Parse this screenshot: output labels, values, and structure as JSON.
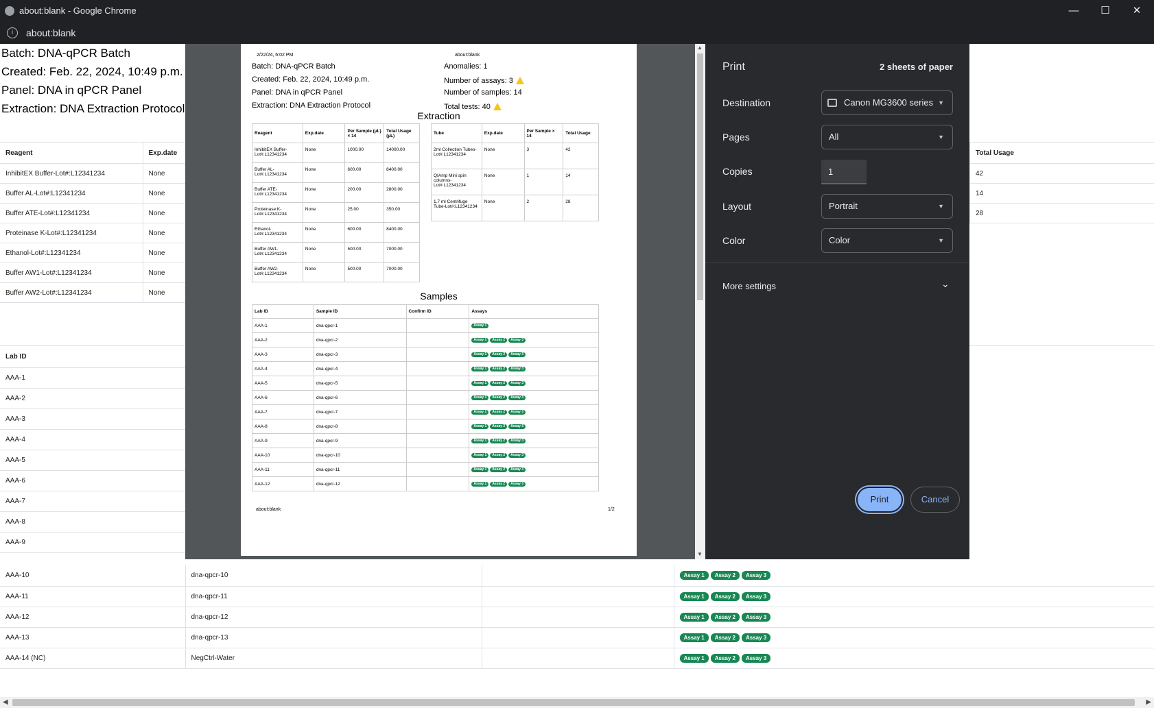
{
  "window": {
    "title": "about:blank - Google Chrome",
    "url": "about:blank",
    "minimize": "—",
    "maximize": "☐",
    "close": "✕"
  },
  "page": {
    "batch": "Batch: DNA-qPCR Batch",
    "created": "Created: Feb. 22, 2024, 10:49 p.m.",
    "panel": "Panel: DNA in qPCR Panel",
    "extraction": "Extraction: DNA Extraction Protocol",
    "reagent_headers": [
      "Reagent",
      "Exp.date"
    ],
    "reagents": [
      {
        "name": "InhibitEX Buffer-Lot#:L12341234",
        "exp": "None"
      },
      {
        "name": "Buffer AL-Lot#:L12341234",
        "exp": "None"
      },
      {
        "name": "Buffer ATE-Lot#:L12341234",
        "exp": "None"
      },
      {
        "name": "Proteinase K-Lot#:L12341234",
        "exp": "None"
      },
      {
        "name": "Ethanol-Lot#:L12341234",
        "exp": "None"
      },
      {
        "name": "Buffer AW1-Lot#:L12341234",
        "exp": "None"
      },
      {
        "name": "Buffer AW2-Lot#:L12341234",
        "exp": "None"
      }
    ],
    "total_usage_header": "Total Usage",
    "total_usage_values": [
      "42",
      "14",
      "28"
    ],
    "lab_id_header": "Lab ID",
    "lab_ids_top": [
      "AAA-1",
      "AAA-2",
      "AAA-3",
      "AAA-4",
      "AAA-5",
      "AAA-6",
      "AAA-7",
      "AAA-8",
      "AAA-9"
    ],
    "lower_rows": [
      {
        "lab": "AAA-10",
        "sample": "dna-qpcr-10"
      },
      {
        "lab": "AAA-11",
        "sample": "dna-qpcr-11"
      },
      {
        "lab": "AAA-12",
        "sample": "dna-qpcr-12"
      },
      {
        "lab": "AAA-13",
        "sample": "dna-qpcr-13"
      },
      {
        "lab": "AAA-14 (NC)",
        "sample": "NegCtrl-Water"
      }
    ],
    "assays": [
      "Assay 1",
      "Assay 2",
      "Assay 3"
    ]
  },
  "print_panel": {
    "title": "Print",
    "sheets": "2 sheets of paper",
    "destination_label": "Destination",
    "destination_value": "Canon MG3600 series",
    "pages_label": "Pages",
    "pages_value": "All",
    "copies_label": "Copies",
    "copies_value": "1",
    "layout_label": "Layout",
    "layout_value": "Portrait",
    "color_label": "Color",
    "color_value": "Color",
    "more_settings": "More settings",
    "print_button": "Print",
    "cancel_button": "Cancel"
  },
  "preview": {
    "header_date": "2/22/24, 6:02 PM",
    "header_url": "about:blank",
    "batch": "Batch: DNA-qPCR Batch",
    "created": "Created: Feb. 22, 2024, 10:49 p.m.",
    "panel": "Panel: DNA in qPCR Panel",
    "extraction": "Extraction: DNA Extraction Protocol",
    "anomalies": "Anomalies: 1",
    "assays_count": "Number of assays: 3",
    "samples_count": "Number of samples: 14",
    "total_tests": "Total tests: 40",
    "extraction_title": "Extraction",
    "reagent_headers": [
      "Reagent",
      "Exp.date",
      "Per Sample (µL) × 14",
      "Total Usage (µL)"
    ],
    "reagents": [
      {
        "name": "InhibitEX Buffer-Lot#:L12341234",
        "exp": "None",
        "per": "1000.00",
        "total": "14000.00"
      },
      {
        "name": "Buffer AL-Lot#:L12341234",
        "exp": "None",
        "per": "600.00",
        "total": "8400.00"
      },
      {
        "name": "Buffer ATE-Lot#:L12341234",
        "exp": "None",
        "per": "200.00",
        "total": "2800.00"
      },
      {
        "name": "Proteinase K-Lot#:L12341234",
        "exp": "None",
        "per": "25.00",
        "total": "350.00"
      },
      {
        "name": "Ethanol-Lot#:L12341234",
        "exp": "None",
        "per": "600.00",
        "total": "8400.00"
      },
      {
        "name": "Buffer AW1-Lot#:L12341234",
        "exp": "None",
        "per": "500.00",
        "total": "7000.00"
      },
      {
        "name": "Buffer AW2-Lot#:L12341234",
        "exp": "None",
        "per": "500.00",
        "total": "7000.00"
      }
    ],
    "tube_headers": [
      "Tube",
      "Exp.date",
      "Per Sample × 14",
      "Total Usage"
    ],
    "tubes": [
      {
        "name": "2ml Collection Tubes-Lot#:L12341234",
        "exp": "None",
        "per": "3",
        "total": "42"
      },
      {
        "name": "QIAmp Mini spin columns-Lot#:L12341234",
        "exp": "None",
        "per": "1",
        "total": "14"
      },
      {
        "name": "1.7 ml Centrifuge Tube-Lot#:L12341234",
        "exp": "None",
        "per": "2",
        "total": "28"
      }
    ],
    "samples_title": "Samples",
    "sample_headers": [
      "Lab ID",
      "Sample ID",
      "Confirm ID",
      "Assays"
    ],
    "samples": [
      {
        "lab": "AAA-1",
        "sample": "dna-qpcr-1",
        "n": 1
      },
      {
        "lab": "AAA-2",
        "sample": "dna-qpcr-2",
        "n": 3
      },
      {
        "lab": "AAA-3",
        "sample": "dna-qpcr-3",
        "n": 3
      },
      {
        "lab": "AAA-4",
        "sample": "dna-qpcr-4",
        "n": 3
      },
      {
        "lab": "AAA-5",
        "sample": "dna-qpcr-5",
        "n": 3
      },
      {
        "lab": "AAA-6",
        "sample": "dna-qpcr-6",
        "n": 3
      },
      {
        "lab": "AAA-7",
        "sample": "dna-qpcr-7",
        "n": 3
      },
      {
        "lab": "AAA-8",
        "sample": "dna-qpcr-8",
        "n": 3
      },
      {
        "lab": "AAA-9",
        "sample": "dna-qpcr-9",
        "n": 3
      },
      {
        "lab": "AAA-10",
        "sample": "dna-qpcr-10",
        "n": 3
      },
      {
        "lab": "AAA-11",
        "sample": "dna-qpcr-11",
        "n": 3
      },
      {
        "lab": "AAA-12",
        "sample": "dna-qpcr-12",
        "n": 3
      }
    ],
    "footer_url": "about:blank",
    "footer_page": "1/2"
  },
  "colors": {
    "pill": "#198754",
    "dark_panel": "#292a2d",
    "print_button": "#8ab4f8"
  }
}
